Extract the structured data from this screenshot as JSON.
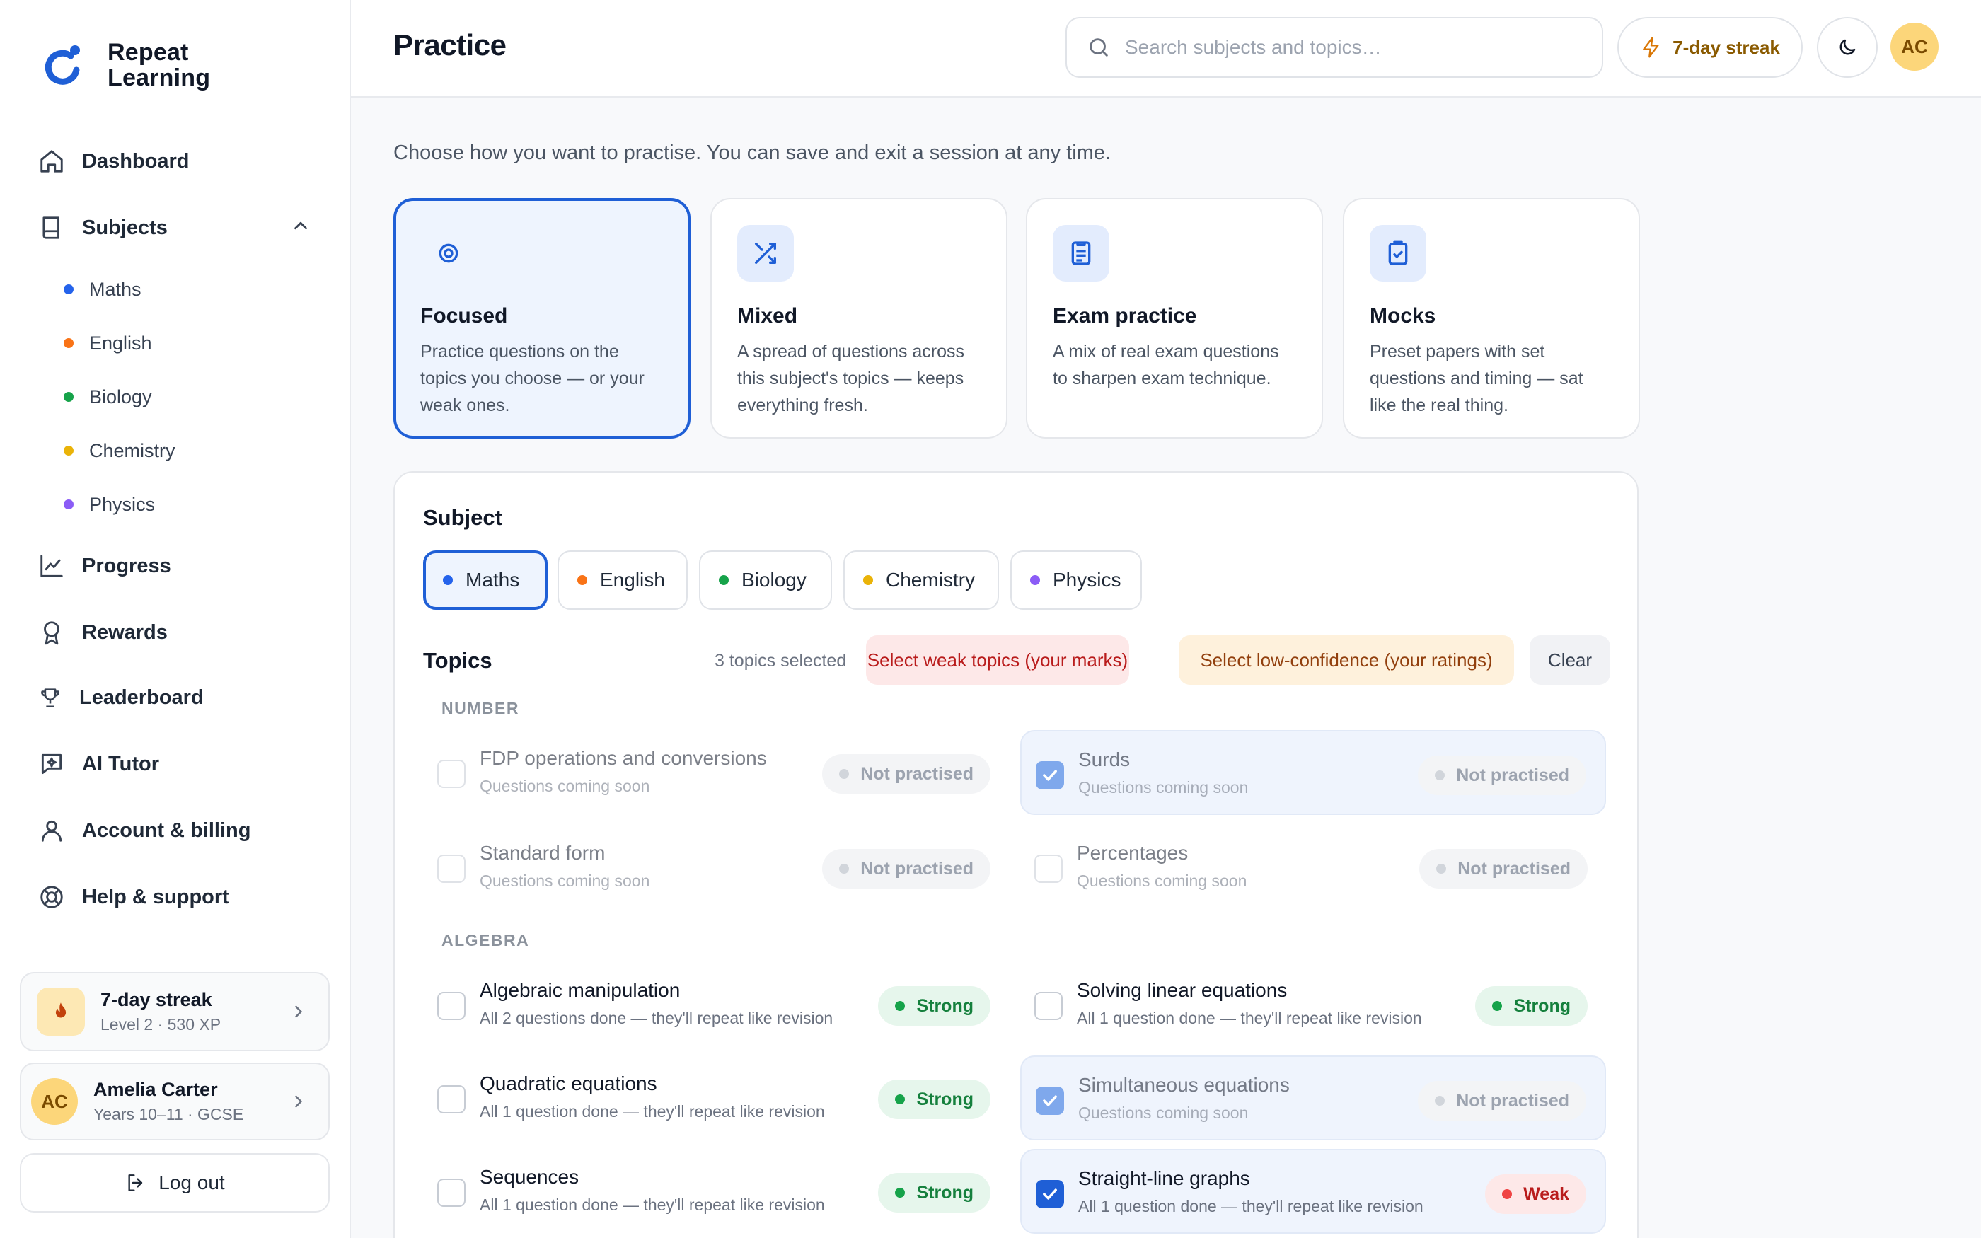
{
  "app": {
    "name_line1": "Repeat",
    "name_line2": "Learning"
  },
  "colors": {
    "accent": "#1f5fd6",
    "maths": "#2563eb",
    "english": "#f97316",
    "biology": "#16a34a",
    "chemistry": "#eab308",
    "physics": "#8b5cf6"
  },
  "sidebar": {
    "nav": {
      "dashboard": "Dashboard",
      "subjects": "Subjects",
      "progress": "Progress",
      "rewards": "Rewards",
      "leaderboard": "Leaderboard",
      "ai_tutor": "AI Tutor",
      "account": "Account & billing",
      "help": "Help & support"
    },
    "subjects": [
      "Maths",
      "English",
      "Biology",
      "Chemistry",
      "Physics"
    ],
    "streak_card": {
      "title": "7-day streak",
      "subtitle": "Level 2 · 530 XP"
    },
    "user_card": {
      "initials": "AC",
      "name": "Amelia Carter",
      "subtitle": "Years 10–11 · GCSE"
    },
    "logout_label": "Log out"
  },
  "header": {
    "title": "Practice",
    "search_placeholder": "Search subjects and topics…",
    "streak_label": "7-day streak",
    "avatar_initials": "AC",
    "icons": [
      "search-icon",
      "lightning-icon",
      "moon-icon"
    ]
  },
  "main": {
    "intro": "Choose how you want to practise. You can save and exit a session at any time.",
    "modes": [
      {
        "title": "Focused",
        "desc": "Practice questions on the topics you choose — or your weak ones.",
        "selected": true
      },
      {
        "title": "Mixed",
        "desc": "A spread of questions across this subject's topics — keeps everything fresh.",
        "selected": false
      },
      {
        "title": "Exam practice",
        "desc": "A mix of real exam questions to sharpen exam technique.",
        "selected": false
      },
      {
        "title": "Mocks",
        "desc": "Preset papers with set questions and timing — sat like the real thing.",
        "selected": false
      }
    ],
    "subject_label": "Subject",
    "subject_chips": [
      "Maths",
      "English",
      "Biology",
      "Chemistry",
      "Physics"
    ],
    "selected_subject": "Maths",
    "topics_label": "Topics",
    "topics_count": "3 topics selected",
    "btn_weak": "Select weak topics (your marks)",
    "btn_low": "Select low-confidence (your ratings)",
    "btn_clear": "Clear",
    "sections": {
      "number": "NUMBER",
      "algebra": "ALGEBRA"
    },
    "topics": [
      {
        "name": "FDP operations and conversions",
        "sub": "Questions coming soon",
        "status": "Not practised",
        "checked": false
      },
      {
        "name": "Surds",
        "sub": "Questions coming soon",
        "status": "Not practised",
        "checked": true
      },
      {
        "name": "Standard form",
        "sub": "Questions coming soon",
        "status": "Not practised",
        "checked": false
      },
      {
        "name": "Percentages",
        "sub": "Questions coming soon",
        "status": "Not practised",
        "checked": false
      },
      {
        "name": "Algebraic manipulation",
        "sub": "All 2 questions done — they'll repeat like revision",
        "status": "Strong",
        "checked": false
      },
      {
        "name": "Solving linear equations",
        "sub": "All 1 question done — they'll repeat like revision",
        "status": "Strong",
        "checked": false
      },
      {
        "name": "Quadratic equations",
        "sub": "All 1 question done — they'll repeat like revision",
        "status": "Strong",
        "checked": false
      },
      {
        "name": "Simultaneous equations",
        "sub": "Questions coming soon",
        "status": "Not practised",
        "checked": true
      },
      {
        "name": "Sequences",
        "sub": "All 1 question done — they'll repeat like revision",
        "status": "Strong",
        "checked": false
      },
      {
        "name": "Straight-line graphs",
        "sub": "All 1 question done — they'll repeat like revision",
        "status": "Weak",
        "checked": true
      }
    ]
  }
}
